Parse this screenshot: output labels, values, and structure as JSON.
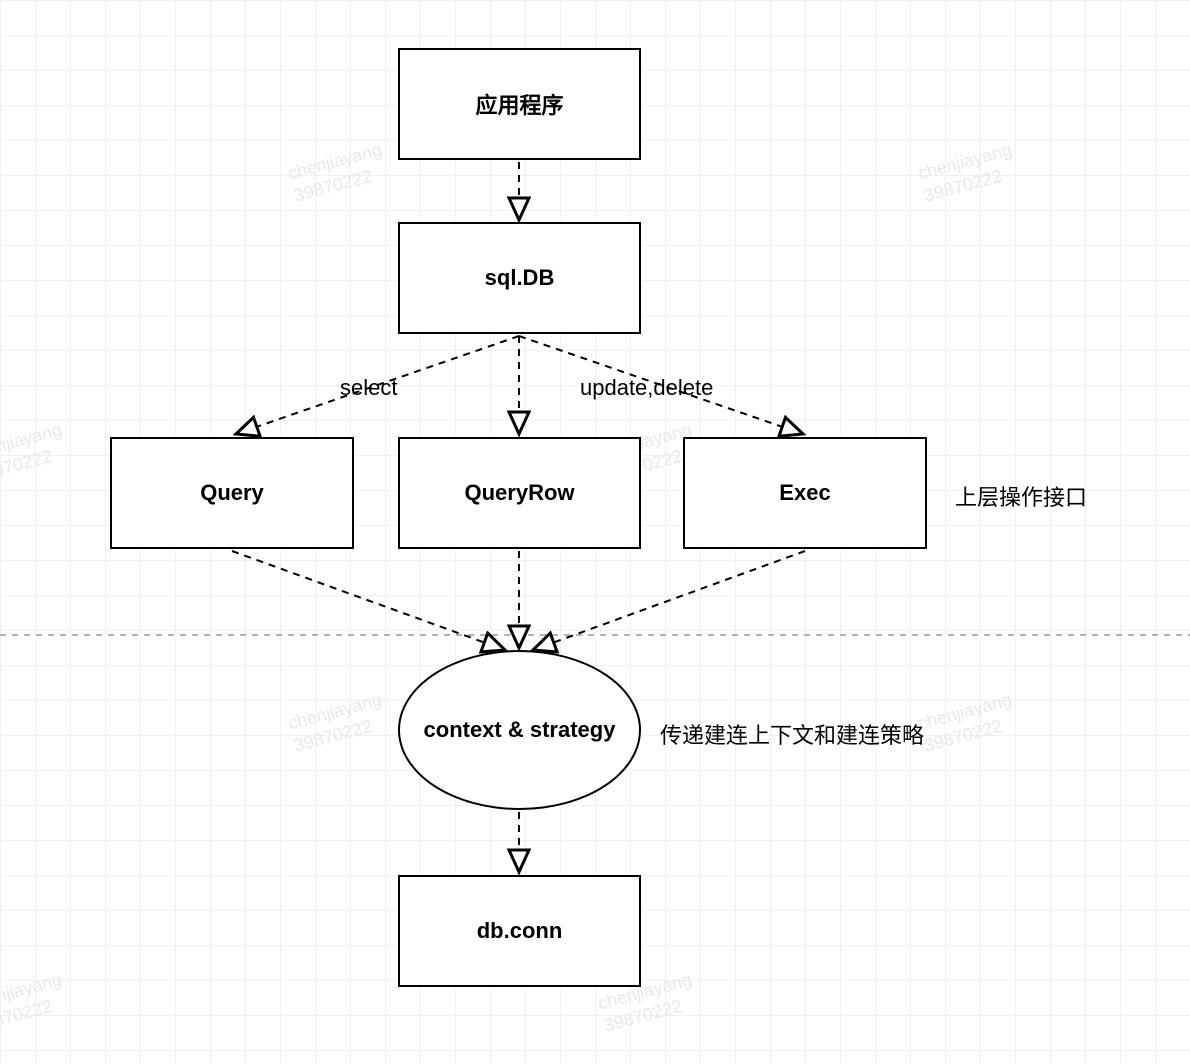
{
  "nodes": {
    "app": {
      "label": "应用程序"
    },
    "sqldb": {
      "label": "sql.DB"
    },
    "query": {
      "label": "Query"
    },
    "queryrow": {
      "label": "QueryRow"
    },
    "exec": {
      "label": "Exec"
    },
    "context": {
      "label": "context & strategy"
    },
    "dbconn": {
      "label": "db.conn"
    }
  },
  "edges": {
    "select": {
      "label": "select"
    },
    "update_delete": {
      "label": "update,delete"
    }
  },
  "annotations": {
    "upper_api": "上层操作接口",
    "conn_strategy": "传递建连上下文和建连策略"
  },
  "watermark": {
    "line1": "chenjiayang",
    "line2": "39870222"
  }
}
